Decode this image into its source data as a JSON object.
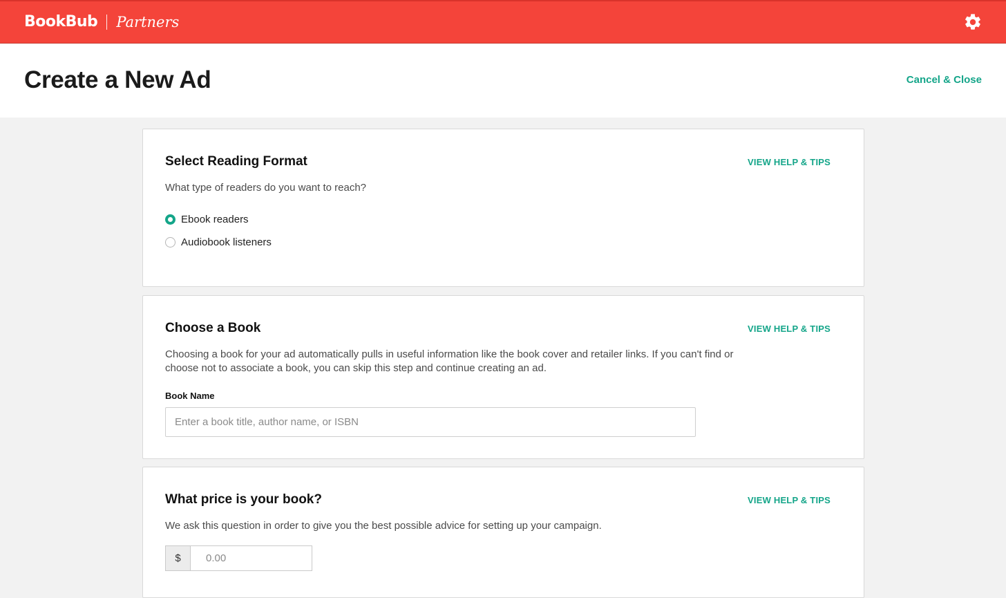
{
  "colors": {
    "brand_red": "#f4443a",
    "accent_green": "#14a589",
    "page_background": "#f2f2f2"
  },
  "topbar": {
    "brand_name": "BookBub",
    "brand_sub": "Partners",
    "settings_icon": "gear-icon"
  },
  "header": {
    "title": "Create a New Ad",
    "cancel_label": "Cancel & Close"
  },
  "reading_format": {
    "title": "Select Reading Format",
    "help_label": "VIEW HELP & TIPS",
    "description": "What type of readers do you want to reach?",
    "options": [
      {
        "label": "Ebook readers",
        "selected": true
      },
      {
        "label": "Audiobook listeners",
        "selected": false
      }
    ]
  },
  "choose_book": {
    "title": "Choose a Book",
    "help_label": "VIEW HELP & TIPS",
    "description": "Choosing a book for your ad automatically pulls in useful information like the book cover and retailer links. If you can't find or choose not to associate a book, you can skip this step and continue creating an ad.",
    "field_label": "Book Name",
    "placeholder": "Enter a book title, author name, or ISBN",
    "value": ""
  },
  "price": {
    "title": "What price is your book?",
    "help_label": "VIEW HELP & TIPS",
    "description": "We ask this question in order to give you the best possible advice for setting up your campaign.",
    "currency_symbol": "$",
    "placeholder": "0.00",
    "value": ""
  }
}
